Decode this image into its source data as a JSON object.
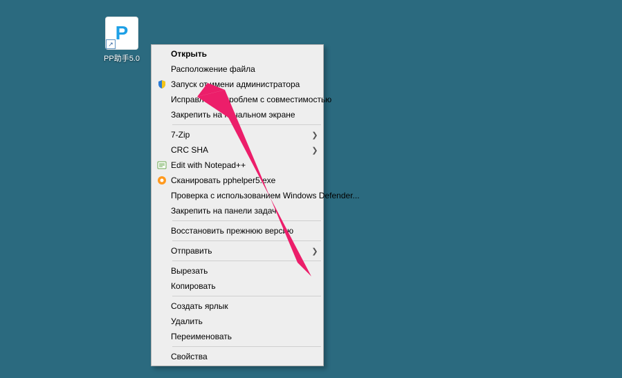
{
  "desktop_icon": {
    "label": "PP助手5.0",
    "glyph": "P"
  },
  "context_menu": {
    "items": [
      {
        "label": "Открыть",
        "bold": true,
        "icon": null,
        "submenu": false
      },
      {
        "label": "Расположение файла",
        "bold": false,
        "icon": null,
        "submenu": false
      },
      {
        "label": "Запуск от имени администратора",
        "bold": false,
        "icon": "shield",
        "submenu": false
      },
      {
        "label": "Исправление проблем с совместимостью",
        "bold": false,
        "icon": null,
        "submenu": false
      },
      {
        "label": "Закрепить на начальном экране",
        "bold": false,
        "icon": null,
        "submenu": false
      },
      {
        "sep": true
      },
      {
        "label": "7-Zip",
        "bold": false,
        "icon": null,
        "submenu": true
      },
      {
        "label": "CRC SHA",
        "bold": false,
        "icon": null,
        "submenu": true
      },
      {
        "label": "Edit with Notepad++",
        "bold": false,
        "icon": "notepadpp",
        "submenu": false
      },
      {
        "label": "Сканировать pphelper5.exe",
        "bold": false,
        "icon": "avast",
        "submenu": false
      },
      {
        "label": "Проверка с использованием Windows Defender...",
        "bold": false,
        "icon": null,
        "submenu": false
      },
      {
        "label": "Закрепить на панели задач",
        "bold": false,
        "icon": null,
        "submenu": false
      },
      {
        "sep": true
      },
      {
        "label": "Восстановить прежнюю версию",
        "bold": false,
        "icon": null,
        "submenu": false
      },
      {
        "sep": true
      },
      {
        "label": "Отправить",
        "bold": false,
        "icon": null,
        "submenu": true
      },
      {
        "sep": true
      },
      {
        "label": "Вырезать",
        "bold": false,
        "icon": null,
        "submenu": false
      },
      {
        "label": "Копировать",
        "bold": false,
        "icon": null,
        "submenu": false
      },
      {
        "sep": true
      },
      {
        "label": "Создать ярлык",
        "bold": false,
        "icon": null,
        "submenu": false
      },
      {
        "label": "Удалить",
        "bold": false,
        "icon": null,
        "submenu": false
      },
      {
        "label": "Переименовать",
        "bold": false,
        "icon": null,
        "submenu": false
      },
      {
        "sep": true
      },
      {
        "label": "Свойства",
        "bold": false,
        "icon": null,
        "submenu": false
      }
    ]
  },
  "annotation": {
    "color": "#ec1e6a",
    "target_item_index": 2
  }
}
